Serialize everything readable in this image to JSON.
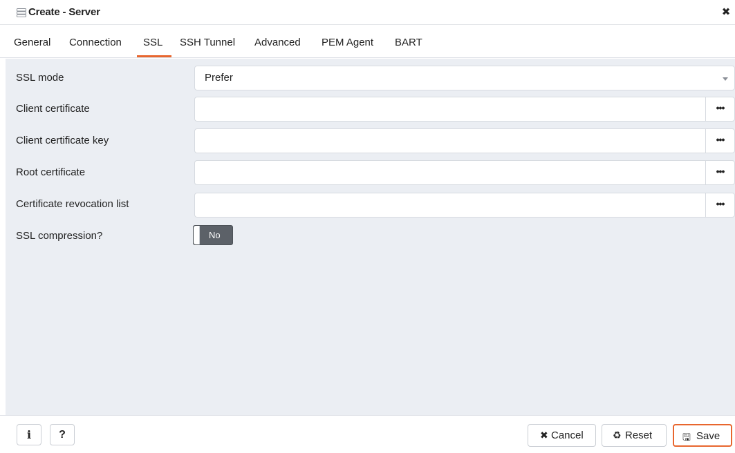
{
  "window": {
    "title": "Create - Server",
    "close_glyph": "✖",
    "title_icon": "server-icon"
  },
  "tabs": [
    {
      "label": "General"
    },
    {
      "label": "Connection"
    },
    {
      "label": "SSL",
      "active": true
    },
    {
      "label": "SSH Tunnel"
    },
    {
      "label": "Advanced"
    },
    {
      "label": "PEM Agent"
    },
    {
      "label": "BART"
    }
  ],
  "form": {
    "ssl_mode": {
      "label": "SSL mode",
      "value": "Prefer"
    },
    "client_certificate": {
      "label": "Client certificate",
      "value": ""
    },
    "client_certificate_key": {
      "label": "Client certificate key",
      "value": ""
    },
    "root_certificate": {
      "label": "Root certificate",
      "value": ""
    },
    "certificate_revocation_list": {
      "label": "Certificate revocation list",
      "value": ""
    },
    "browse_glyph": "•••",
    "ssl_compression": {
      "label": "SSL compression?",
      "value": "No"
    }
  },
  "footer": {
    "info_glyph": "i",
    "help_glyph": "?",
    "cancel": {
      "label": "Cancel",
      "glyph": "✖"
    },
    "reset": {
      "label": "Reset",
      "glyph": "♻"
    },
    "save": {
      "label": "Save",
      "glyph": "🖫"
    }
  },
  "colors": {
    "accent": "#e8662e",
    "panel_bg": "#ebeef3",
    "toggle_off": "#5c6168"
  }
}
